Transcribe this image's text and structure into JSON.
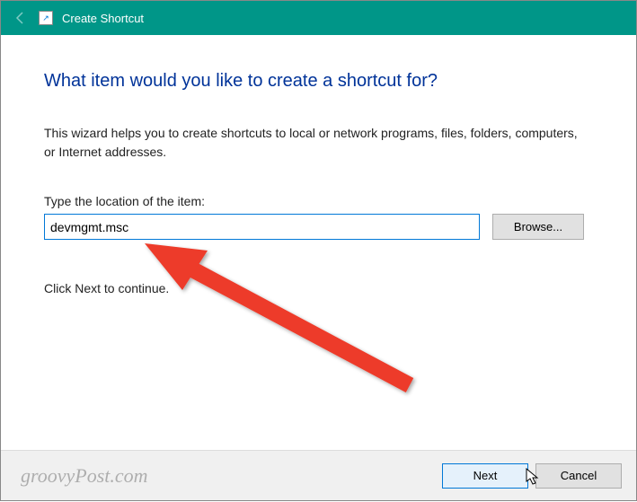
{
  "titlebar": {
    "title": "Create Shortcut"
  },
  "content": {
    "heading": "What item would you like to create a shortcut for?",
    "description": "This wizard helps you to create shortcuts to local or network programs, files, folders, computers, or Internet addresses.",
    "location_label": "Type the location of the item:",
    "location_value": "devmgmt.msc",
    "browse_label": "Browse...",
    "continue_text": "Click Next to continue."
  },
  "footer": {
    "watermark": "groovyPost.com",
    "next_label": "Next",
    "cancel_label": "Cancel"
  }
}
